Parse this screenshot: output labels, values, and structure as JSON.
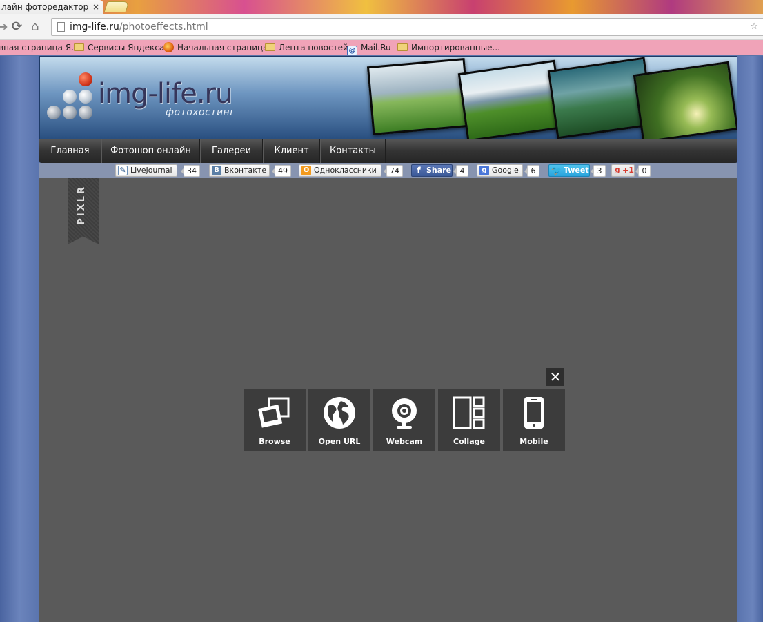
{
  "browser": {
    "tab_title": "лайн фоторедактор с",
    "tab_close": "×",
    "url_host": "img-life.ru",
    "url_path": "/photoeffects.html",
    "bookmarks": [
      {
        "label": "вная страница Я...",
        "icon": "none"
      },
      {
        "label": "Сервисы Яндекса",
        "icon": "folder-icon"
      },
      {
        "label": "Начальная страница",
        "icon": "firefox-icon"
      },
      {
        "label": "Лента новостей",
        "icon": "folder-icon"
      },
      {
        "label": "Mail.Ru",
        "icon": "mailru-icon"
      },
      {
        "label": "Импортированные...",
        "icon": "folder-icon"
      }
    ]
  },
  "header": {
    "logo_text": "img-life.ru",
    "logo_tagline": "фотохостинг"
  },
  "menu": {
    "items": [
      "Главная",
      "Фотошоп онлайн",
      "Галереи",
      "Клиент",
      "Контакты"
    ]
  },
  "share": {
    "buttons": [
      {
        "label": "LiveJournal",
        "count": "34"
      },
      {
        "label": "Вконтакте",
        "count": "49"
      },
      {
        "label": "Одноклассники",
        "count": "74"
      },
      {
        "label": "Share",
        "count": "4"
      },
      {
        "label": "Google",
        "count": "6"
      },
      {
        "label": "Tweet",
        "count": "3"
      },
      {
        "label": "+1",
        "count": "0"
      }
    ]
  },
  "pixlr": {
    "ribbon": "PIXLR",
    "close": "✕",
    "tiles": [
      {
        "label": "Browse",
        "icon": "browse-icon"
      },
      {
        "label": "Open URL",
        "icon": "globe-icon"
      },
      {
        "label": "Webcam",
        "icon": "webcam-icon"
      },
      {
        "label": "Collage",
        "icon": "collage-icon"
      },
      {
        "label": "Mobile",
        "icon": "mobile-icon"
      }
    ]
  },
  "colors": {
    "page_bg": "#5a74a8",
    "pixlr_bg": "#5a5a5a",
    "tile_bg": "#3c3c3c",
    "menu_bg": "#333333",
    "bookmark_bar": "#f0a3b8"
  }
}
